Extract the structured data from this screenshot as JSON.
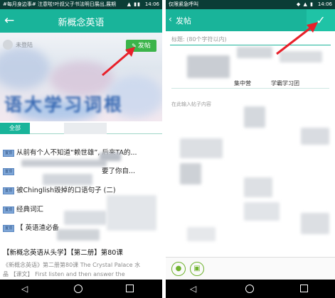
{
  "left": {
    "statusbar": {
      "text": "#每月身边事# 注意啦!叶叔父子书法明日展出,展期",
      "time": "14:06"
    },
    "appbar": {
      "back_icon": "←",
      "title": "新概念英语"
    },
    "banner": {
      "login_text": "未登陆",
      "post_label": "发帖",
      "banner_text": "语大学习词根"
    },
    "tabs": {
      "all_label": "全部"
    },
    "list": [
      {
        "tag": "置顶",
        "text": "从前有个人不知道“赖世雄”, 后来TA的..."
      },
      {
        "tag": "置顶",
        "text": "要了你自..."
      },
      {
        "tag": "置顶",
        "text": "被Chinglish毁掉的口语句子 (二)"
      },
      {
        "tag": "置顶",
        "text": "经典词汇"
      },
      {
        "tag": "置顶",
        "text": "【 英语渣必备"
      }
    ],
    "article": {
      "title": "【新概念英语从头学】【第二册】第80课",
      "subtitle": "《新概念英语》第二册第80课 The Crystal Palace 水",
      "subtitle2": "晶 【课文】 First listen and then answer the"
    }
  },
  "right": {
    "statusbar": {
      "text": "仅限紧急呼叫",
      "time": "14:06"
    },
    "appbar": {
      "back_icon": "‹",
      "title": "发帖",
      "confirm_icon": "✓"
    },
    "title_placeholder": "标题: (80个字符以内)",
    "group_a": "集中营",
    "group_b": "学霸学习团",
    "content_placeholder": "在此输入帖子内容"
  },
  "colors": {
    "brand": "#19b49a",
    "post_button": "#3bb44a",
    "arrow": "#e8202a",
    "tag": "#7fa7d8"
  }
}
